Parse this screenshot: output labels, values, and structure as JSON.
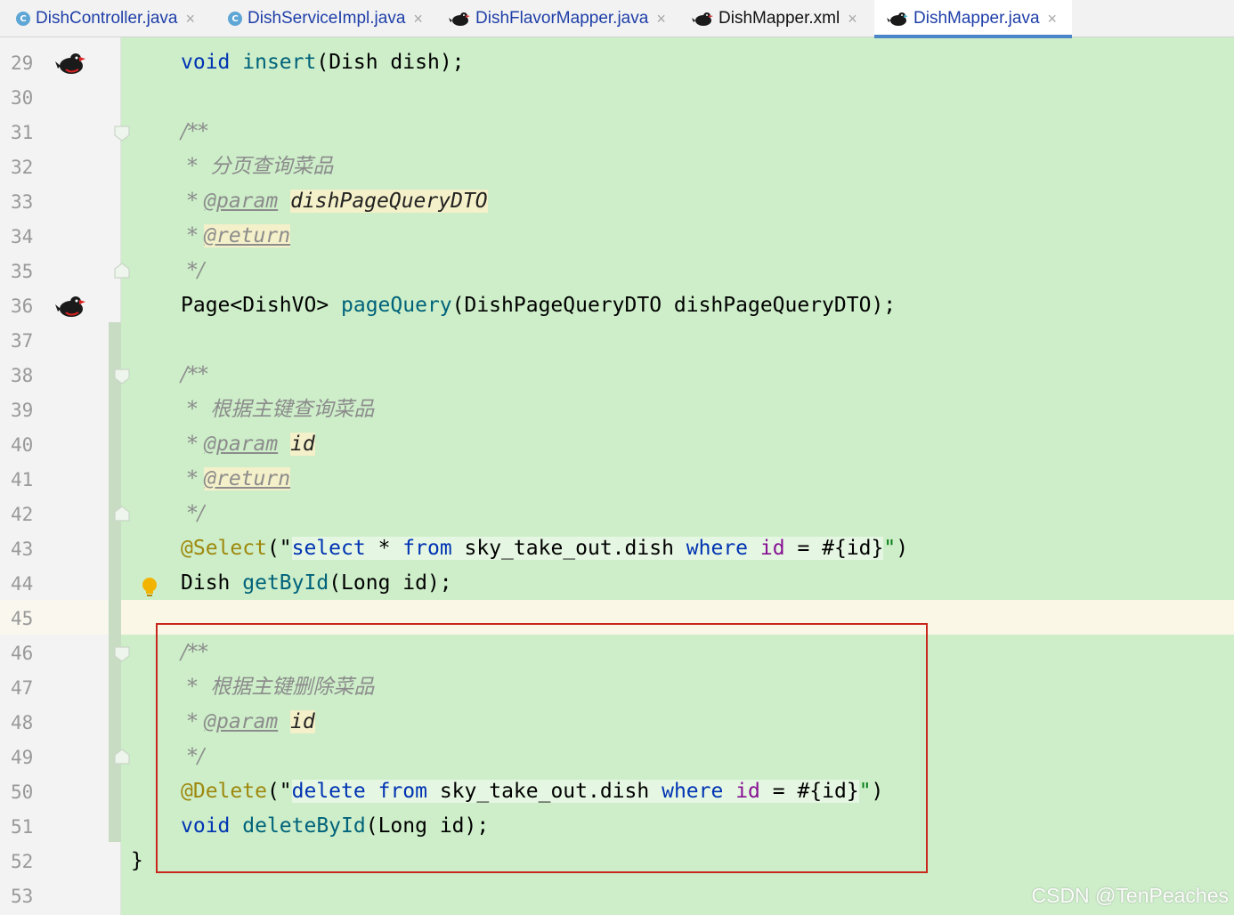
{
  "tabs": [
    {
      "label": "DishController.java",
      "icon": "class-c-icon",
      "active": false
    },
    {
      "label": "DishServiceImpl.java",
      "icon": "class-c-icon",
      "active": false
    },
    {
      "label": "DishFlavorMapper.java",
      "icon": "mybatis-bird-icon",
      "active": false
    },
    {
      "label": "DishMapper.xml",
      "icon": "mybatis-bird-icon",
      "active": false
    },
    {
      "label": "DishMapper.java",
      "icon": "mybatis-bird-icon",
      "active": true
    }
  ],
  "class_badge": "C",
  "close_glyph": "×",
  "line_numbers": [
    "29",
    "30",
    "31",
    "32",
    "33",
    "34",
    "35",
    "36",
    "37",
    "38",
    "39",
    "40",
    "41",
    "42",
    "43",
    "44",
    "45",
    "46",
    "47",
    "48",
    "49",
    "50",
    "51",
    "52",
    "53"
  ],
  "code": {
    "l29": {
      "kw": "void",
      "fn": "insert",
      "rest": "(Dish dish);"
    },
    "l31": "/**",
    "l32": " *  分页查询菜品",
    "l33": {
      "star": " * ",
      "tag": "@param",
      "param": "dishPageQueryDTO"
    },
    "l34": {
      "star": " * ",
      "tag": "@return"
    },
    "l35": " */",
    "l36": {
      "pre": "Page<DishVO> ",
      "fn": "pageQuery",
      "rest": "(DishPageQueryDTO dishPageQueryDTO);"
    },
    "l38": "/**",
    "l39": " *  根据主键查询菜品",
    "l40": {
      "star": " * ",
      "tag": "@param",
      "param": "id"
    },
    "l41": {
      "star": " * ",
      "tag": "@return"
    },
    "l42": " */",
    "l43": {
      "ann": "@Select",
      "open": "(\"",
      "s1": "select",
      "s2": " * ",
      "s3": "from",
      "s4": " sky_take_out.dish ",
      "s5": "where",
      "s6": "id",
      "s7": " = #{id}",
      "close_q": "\"",
      "close": ")"
    },
    "l44": {
      "pre": "Dish ",
      "fn": "getById",
      "rest": "(Long id);"
    },
    "l46": "/**",
    "l47": " *  根据主键删除菜品",
    "l48": {
      "star": " * ",
      "tag": "@param",
      "param": "id"
    },
    "l49": " */",
    "l50": {
      "ann": "@Delete",
      "open": "(\"",
      "s1": "delete",
      "s3": "from",
      "s4": " sky_take_out.dish ",
      "s5": "where",
      "s6": "id",
      "s7": " = #{id}",
      "close_q": "\"",
      "close": ")"
    },
    "l51": {
      "kw": "void",
      "fn": "deleteById",
      "rest": "(Long id);"
    },
    "l52": "}"
  },
  "watermark": "CSDN @TenPeaches",
  "colors": {
    "editor_bg": "#cdeec9",
    "keyword": "#0033b3",
    "function": "#00627a",
    "annotation": "#9e880d",
    "highlight_box": "#c8271e"
  }
}
